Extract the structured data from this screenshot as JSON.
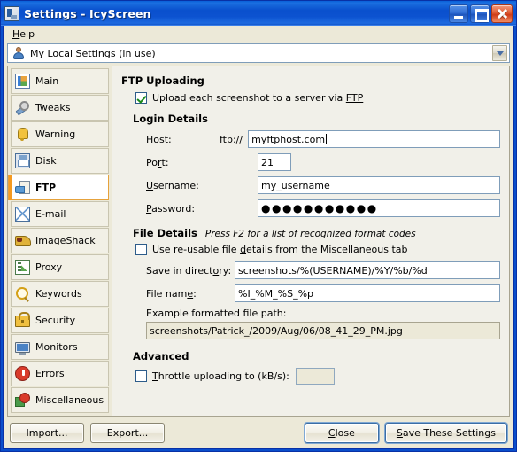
{
  "window": {
    "title": "Settings - IcyScreen",
    "icon": "app-icon",
    "buttons": {
      "minimize": "minimize",
      "maximize": "maximize",
      "close": "close"
    }
  },
  "menubar": {
    "items": [
      {
        "label": "Help",
        "accel": "H"
      }
    ]
  },
  "profile_combo": {
    "value": "My Local Settings (in use)",
    "icon": "user-icon",
    "arrow_icon": "chevron-down-icon"
  },
  "sidebar": {
    "items": [
      {
        "label": "Main",
        "icon": "main-icon",
        "selected": false
      },
      {
        "label": "Tweaks",
        "icon": "tweaks-icon",
        "selected": false
      },
      {
        "label": "Warning",
        "icon": "warning-icon",
        "selected": false
      },
      {
        "label": "Disk",
        "icon": "disk-icon",
        "selected": false
      },
      {
        "label": "FTP",
        "icon": "ftp-icon",
        "selected": true
      },
      {
        "label": "E-mail",
        "icon": "email-icon",
        "selected": false
      },
      {
        "label": "ImageShack",
        "icon": "imageshack-icon",
        "selected": false
      },
      {
        "label": "Proxy",
        "icon": "proxy-icon",
        "selected": false
      },
      {
        "label": "Keywords",
        "icon": "keywords-icon",
        "selected": false
      },
      {
        "label": "Security",
        "icon": "security-icon",
        "selected": false
      },
      {
        "label": "Monitors",
        "icon": "monitors-icon",
        "selected": false
      },
      {
        "label": "Errors",
        "icon": "errors-icon",
        "selected": false
      },
      {
        "label": "Miscellaneous",
        "icon": "misc-icon",
        "selected": false
      }
    ]
  },
  "panel": {
    "group_title": "FTP Uploading",
    "upload_checkbox": {
      "label_before": "Upload each screenshot to a server via ",
      "accel": "FTP",
      "label_after": "",
      "checked": true
    },
    "login": {
      "title": "Login Details",
      "host": {
        "label_before": "H",
        "accel": "o",
        "label_after": "st:",
        "prefix": "ftp://",
        "value": "myftphost.com"
      },
      "port": {
        "label_before": "Po",
        "accel": "r",
        "label_after": "t:",
        "value": "21"
      },
      "username": {
        "accel": "U",
        "label_after": "sername:",
        "value": "my_username"
      },
      "password": {
        "accel": "P",
        "label_after": "assword:",
        "value": "●●●●●●●●●●●"
      }
    },
    "file_details": {
      "title": "File Details",
      "hint": "Press F2 for a list of recognized format codes",
      "reusable_checkbox": {
        "label_before": "Use re-usable file ",
        "accel": "d",
        "label_after": "etails from the Miscellaneous tab",
        "checked": false
      },
      "save_dir": {
        "label_before": "Save in direct",
        "accel": "o",
        "label_after": "ry:",
        "value": "screenshots/%(USERNAME)/%Y/%b/%d"
      },
      "file_name": {
        "label_before": "File nam",
        "accel": "e",
        "label_after": ":",
        "value": "%I_%M_%S_%p"
      },
      "example": {
        "label": "Example formatted file path:",
        "value": "screenshots/Patrick_/2009/Aug/06/08_41_29_PM.jpg"
      }
    },
    "advanced": {
      "title": "Advanced",
      "throttle_checkbox": {
        "accel": "T",
        "label_after": "hrottle uploading to (kB/s):",
        "checked": false
      },
      "throttle_value": ""
    }
  },
  "footer": {
    "import": {
      "label": "Import...",
      "focused": false
    },
    "export": {
      "label": "Export...",
      "focused": false
    },
    "close": {
      "label_before": "",
      "accel": "C",
      "label_after": "lose",
      "focused": true
    },
    "save": {
      "label_before": "",
      "accel": "S",
      "label_after": "ave These Settings",
      "focused": true
    }
  },
  "colors": {
    "titlebar_blue": "#0a50cd",
    "accent_orange": "#f59a20",
    "panel_bg": "#f1f0e9",
    "dialog_bg": "#ece9d8",
    "field_border": "#7f9db9",
    "close_red": "#cf3c18"
  }
}
